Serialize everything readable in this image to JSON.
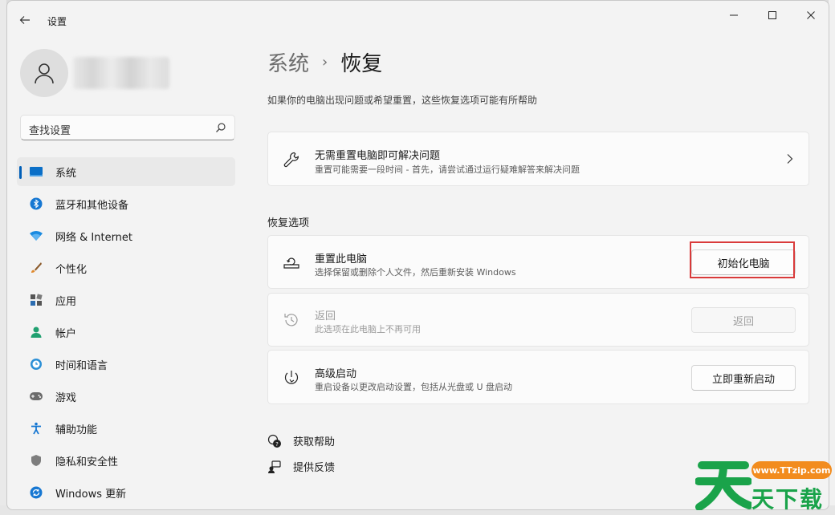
{
  "window": {
    "app_title": "设置"
  },
  "sidebar": {
    "search_placeholder": "查找设置",
    "items": [
      {
        "label": "系统",
        "icon": "system-icon",
        "active": true
      },
      {
        "label": "蓝牙和其他设备",
        "icon": "bluetooth-icon"
      },
      {
        "label": "网络 & Internet",
        "icon": "network-icon"
      },
      {
        "label": "个性化",
        "icon": "personalization-icon"
      },
      {
        "label": "应用",
        "icon": "apps-icon"
      },
      {
        "label": "帐户",
        "icon": "account-icon"
      },
      {
        "label": "时间和语言",
        "icon": "time-language-icon"
      },
      {
        "label": "游戏",
        "icon": "gaming-icon"
      },
      {
        "label": "辅助功能",
        "icon": "accessibility-icon"
      },
      {
        "label": "隐私和安全性",
        "icon": "privacy-icon"
      },
      {
        "label": "Windows 更新",
        "icon": "windows-update-icon"
      }
    ]
  },
  "main": {
    "breadcrumb_parent": "系统",
    "breadcrumb_current": "恢复",
    "description": "如果你的电脑出现问题或希望重置，这些恢复选项可能有所帮助",
    "troubleshoot_card": {
      "title": "无需重置电脑即可解决问题",
      "subtitle": "重置可能需要一段时间 - 首先，请尝试通过运行疑难解答来解决问题"
    },
    "section_title": "恢复选项",
    "reset_card": {
      "title": "重置此电脑",
      "subtitle": "选择保留或删除个人文件，然后重新安装 Windows",
      "button": "初始化电脑"
    },
    "goback_card": {
      "title": "返回",
      "subtitle": "此选项在此电脑上不再可用",
      "button": "返回"
    },
    "advanced_card": {
      "title": "高级启动",
      "subtitle": "重启设备以更改启动设置，包括从光盘或 U 盘启动",
      "button": "立即重新启动"
    },
    "links": {
      "help": "获取帮助",
      "feedback": "提供反馈"
    }
  },
  "watermark": {
    "url": "www.TTzip.com",
    "text": "天下载"
  },
  "colors": {
    "accent": "#005fb8",
    "highlight": "#d93a3a",
    "watermark_green": "#1aa34a",
    "watermark_orange": "#f28c1e"
  }
}
